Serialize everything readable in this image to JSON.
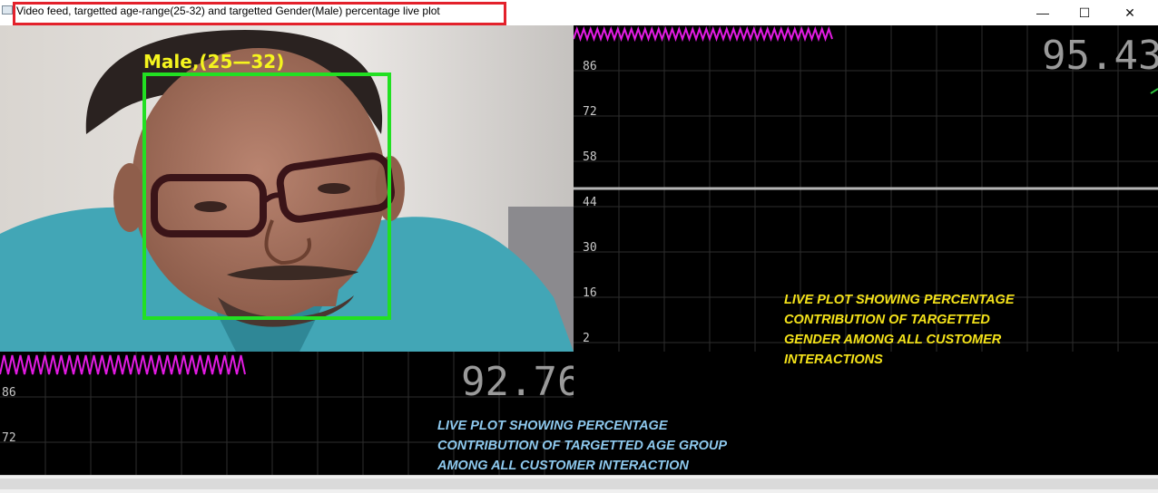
{
  "window": {
    "title": "Video feed, targetted age-range(25-32) and targetted Gender(Male) percentage live plot",
    "minimize_glyph": "—",
    "maximize_glyph": "☐",
    "close_glyph": "✕",
    "highlight_color": "#e3212b"
  },
  "video": {
    "detection_label": "Male,(25—32)",
    "box_color": "#22e022",
    "label_color": "#f5f51e"
  },
  "gender_plot": {
    "current_value": "95.43",
    "ticks": [
      "86",
      "72",
      "58",
      "44",
      "30",
      "16",
      "2"
    ],
    "line_color": "#b5b5b5",
    "wave_color": "#e21be2",
    "annotation": [
      "LIVE PLOT SHOWING PERCENTAGE",
      "CONTRIBUTION OF TARGETTED",
      "GENDER AMONG ALL CUSTOMER",
      "INTERACTIONS"
    ],
    "annotation_color": "#f5e31a"
  },
  "age_plot": {
    "current_value": "92.76",
    "ticks": [
      "86",
      "72"
    ],
    "wave_color": "#e21be2",
    "annotation": [
      "LIVE PLOT SHOWING PERCENTAGE",
      "CONTRIBUTION OF TARGETTED AGE GROUP",
      "AMONG ALL CUSTOMER INTERACTION"
    ],
    "annotation_color": "#8ec9ee"
  }
}
